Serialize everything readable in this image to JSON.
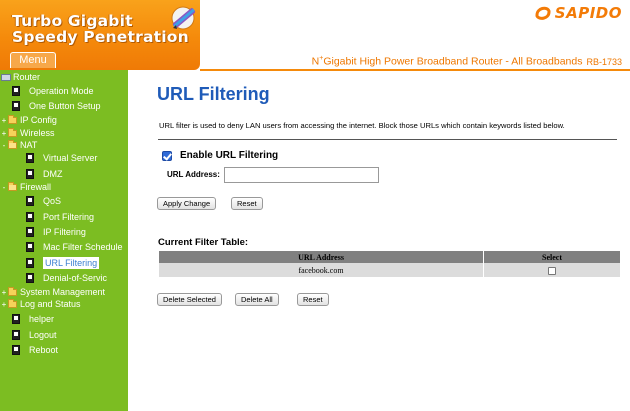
{
  "header": {
    "brand_line1": "Turbo Gigabit",
    "brand_line2": "Speedy Penetration",
    "menu_tab": "Menu",
    "logo_text": "SAPIDO",
    "tagline_prefix": "N",
    "tagline_sup": "+",
    "tagline_main": "Gigabit High Power Broadband Router - All Broadbands",
    "tagline_model": "RB-1733"
  },
  "sidebar": {
    "items": [
      {
        "label": "Router"
      },
      {
        "label": "Operation Mode"
      },
      {
        "label": "One Button Setup"
      },
      {
        "label": "IP Config",
        "expander": "+"
      },
      {
        "label": "Wireless",
        "expander": "+"
      },
      {
        "label": "NAT",
        "expander": "-"
      },
      {
        "label": "Virtual Server"
      },
      {
        "label": "DMZ"
      },
      {
        "label": "Firewall",
        "expander": "-"
      },
      {
        "label": "QoS"
      },
      {
        "label": "Port Filtering"
      },
      {
        "label": "IP Filtering"
      },
      {
        "label": "Mac Filter Schedule"
      },
      {
        "label": "URL Filtering"
      },
      {
        "label": "Denial-of-Servic"
      },
      {
        "label": "System Management",
        "expander": "+"
      },
      {
        "label": "Log and Status",
        "expander": "+"
      },
      {
        "label": "helper"
      },
      {
        "label": "Logout"
      },
      {
        "label": "Reboot"
      }
    ]
  },
  "main": {
    "title": "URL Filtering",
    "description": "URL filter is used to deny LAN users from accessing the internet. Block those URLs which contain keywords listed below.",
    "enable_label": "Enable URL Filtering",
    "enable_checked": true,
    "url_label": "URL Address:",
    "url_value": "",
    "apply_button": "Apply Change",
    "reset_button": "Reset",
    "table_title": "Current Filter Table:",
    "table_headers": [
      "URL Address",
      "Select"
    ],
    "table_rows": [
      {
        "url": "facebook.com",
        "selected": false
      }
    ],
    "delete_selected_button": "Delete Selected",
    "delete_all_button": "Delete All",
    "table_reset_button": "Reset"
  },
  "colors": {
    "brand_orange": "#f58a0b",
    "sidebar_green": "#7cbd22",
    "title_blue": "#1f5bb8",
    "table_header_gray": "#808080",
    "table_row_gray": "#dcdcdc"
  },
  "icons": {
    "brand": "pen-orb-icon",
    "logo": "sapido-swirl-icon",
    "folder": "folder-icon",
    "page": "page-icon",
    "root": "computer-icon"
  }
}
